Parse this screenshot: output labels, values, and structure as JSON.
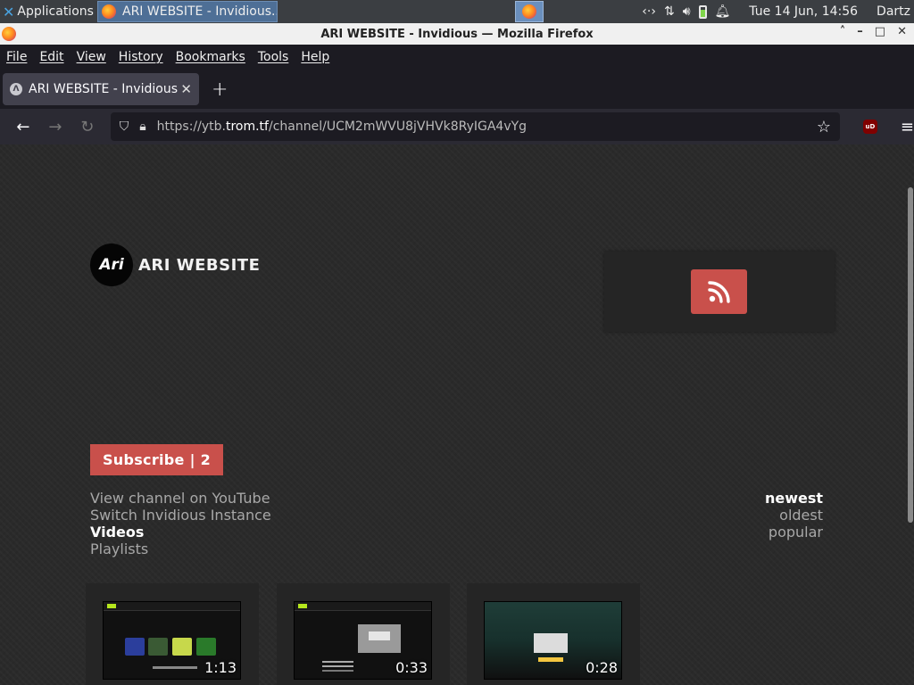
{
  "taskbar": {
    "apps_label": "Applications",
    "task_title": "ARI WEBSITE - Invidious...",
    "clock": "Tue 14 Jun, 14:56",
    "user": "Dartz"
  },
  "window": {
    "title": "ARI WEBSITE - Invidious — Mozilla Firefox"
  },
  "menubar": {
    "items": [
      "File",
      "Edit",
      "View",
      "History",
      "Bookmarks",
      "Tools",
      "Help"
    ]
  },
  "tab": {
    "title": "ARI WEBSITE - Invidious",
    "favicon": "Λ"
  },
  "navbar": {
    "url_prefix": "https://ytb.",
    "url_domain": "trom.tf",
    "url_suffix": "/channel/UCM2mWVU8jVHVk8RyIGA4vYg",
    "ublock_label": "uD"
  },
  "channel": {
    "avatar_text": "Ari",
    "name": "ARI WEBSITE",
    "subscribe_label": "Subscribe | 2",
    "links": [
      "View channel on YouTube",
      "Switch Invidious Instance",
      "Videos",
      "Playlists"
    ],
    "sort": [
      "newest",
      "oldest",
      "popular"
    ]
  },
  "videos": [
    {
      "duration": "1:13"
    },
    {
      "duration": "0:33"
    },
    {
      "duration": "0:28"
    }
  ],
  "colors": {
    "accent_red": "#c9504b",
    "page_bg": "#2a2a2a",
    "tab_active": "#42414d"
  }
}
